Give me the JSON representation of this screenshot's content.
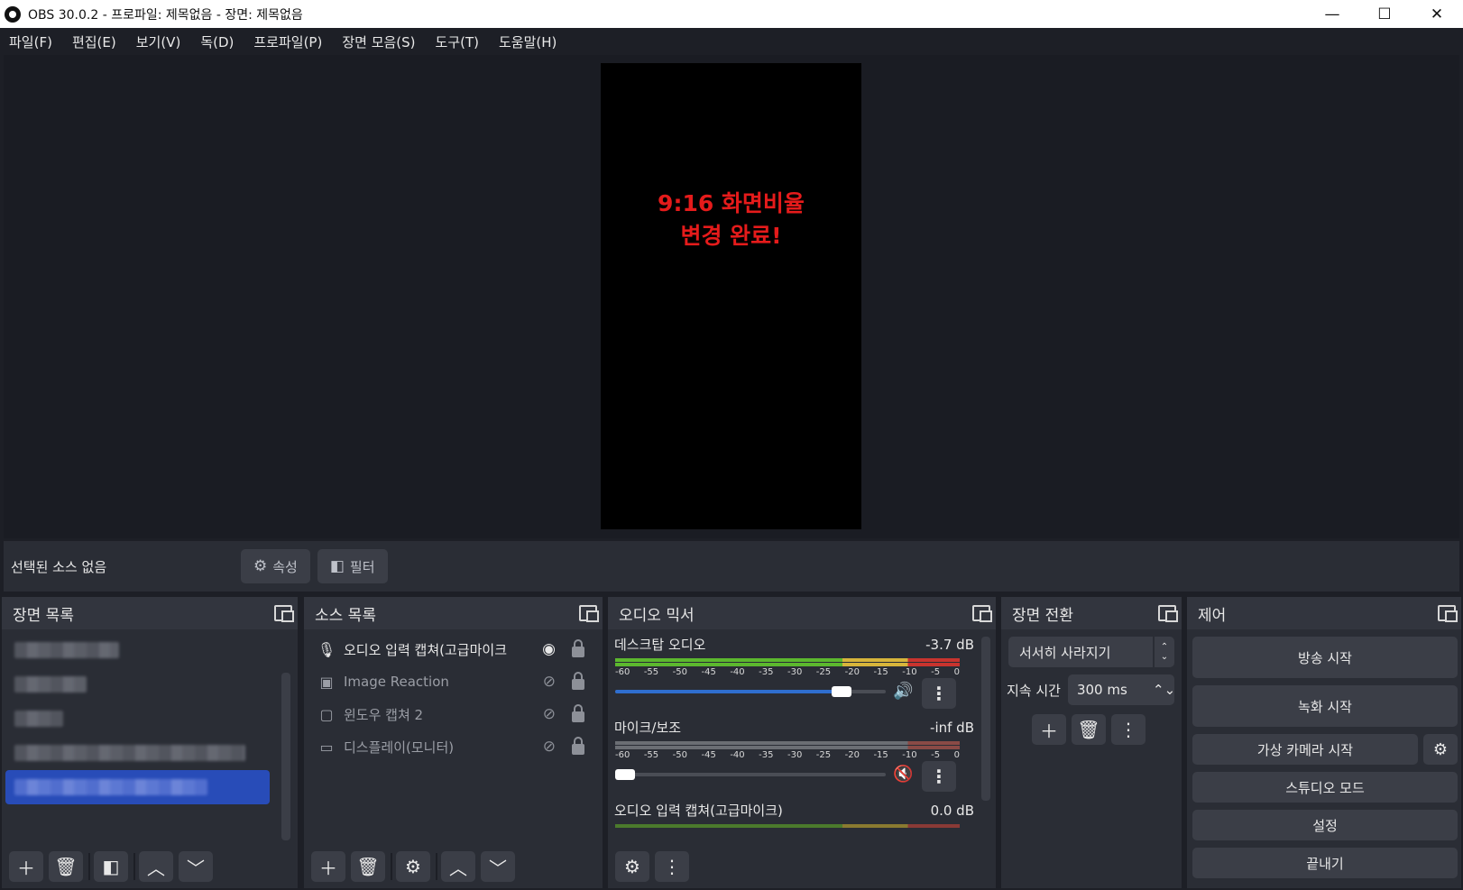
{
  "window": {
    "title": "OBS 30.0.2 - 프로파일: 제목없음 - 장면: 제목없음",
    "minimize": "—",
    "maximize": "☐",
    "close": "✕"
  },
  "menu": [
    "파일(F)",
    "편집(E)",
    "보기(V)",
    "독(D)",
    "프로파일(P)",
    "장면 모음(S)",
    "도구(T)",
    "도움말(H)"
  ],
  "preview": {
    "overlay_line1": "9:16  화면비율",
    "overlay_line2": "변경 완료!",
    "overlay_color": "#e51b1b"
  },
  "source_toolbar": {
    "no_selection": "선택된 소스 없음",
    "properties_label": "속성",
    "filters_label": "필터"
  },
  "scenes": {
    "title": "장면 목록",
    "selected_index": 4,
    "accent": "#284cb8"
  },
  "sources": {
    "title": "소스 목록",
    "items": [
      {
        "label": "오디오 입력 캡쳐(고급마이크",
        "icon": "mic-icon",
        "visible": true
      },
      {
        "label": "Image Reaction",
        "icon": "image-icon",
        "visible": false
      },
      {
        "label": "윈도우 캡쳐 2",
        "icon": "window-icon",
        "visible": false
      },
      {
        "label": "디스플레이(모니터)",
        "icon": "monitor-icon",
        "visible": false
      }
    ]
  },
  "mixer": {
    "title": "오디오 믹서",
    "ticks": [
      "-60",
      "-55",
      "-50",
      "-45",
      "-40",
      "-35",
      "-30",
      "-25",
      "-20",
      "-15",
      "-10",
      "-5",
      "0"
    ],
    "channels": [
      {
        "name": "데스크탑 오디오",
        "db": "-3.7 dB",
        "level": 0.9,
        "muted": false
      },
      {
        "name": "마이크/보조",
        "db": "-inf dB",
        "level": 0.0,
        "muted": true
      },
      {
        "name": "오디오 입력 캡쳐(고급마이크)",
        "db": "0.0 dB",
        "level": 1.0,
        "muted": false
      }
    ]
  },
  "transitions": {
    "title": "장면 전환",
    "selected": "서서히 사라지기",
    "duration_label": "지속 시간",
    "duration_value": "300 ms"
  },
  "controls": {
    "title": "제어",
    "start_streaming": "방송 시작",
    "start_recording": "녹화 시작",
    "start_virtual_cam": "가상 카메라 시작",
    "studio_mode": "스튜디오 모드",
    "settings": "설정",
    "exit": "끝내기"
  }
}
